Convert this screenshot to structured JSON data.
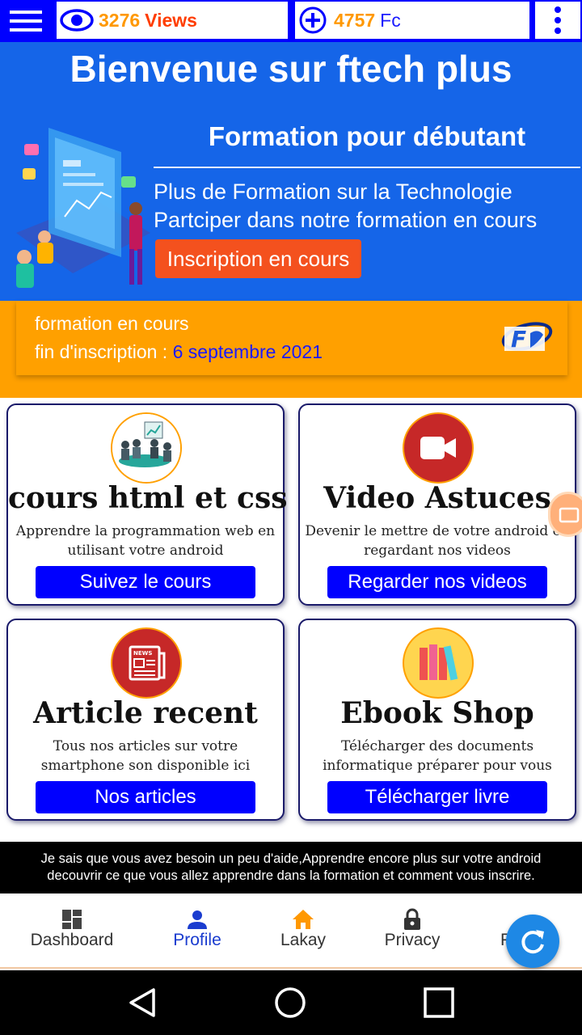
{
  "topbar": {
    "views_count": "3276",
    "views_label": "Views",
    "fc_count": "4757",
    "fc_label": "Fc",
    "icons": [
      "menu-icon",
      "eye-icon",
      "plus-circle-icon",
      "more-vert-icon"
    ]
  },
  "hero": {
    "title": "Bienvenue sur ftech plus",
    "subtitle": "Formation pour débutant",
    "line1": "Plus de Formation sur la Technologie",
    "line2": "Partciper dans notre formation en cours",
    "button": "Inscription en cours"
  },
  "band": {
    "line1": "formation en cours",
    "line2_label": "fin d'inscription :",
    "line2_date": "6 septembre 2021"
  },
  "cards": [
    {
      "title": "cours html et css",
      "desc": "Apprendre la programmation web en utilisant votre android",
      "button": "Suivez le cours",
      "icon": "meeting-icon"
    },
    {
      "title": "Video Astuces",
      "desc": "Devenir le mettre de votre android en regardant nos videos",
      "button": "Regarder nos videos",
      "icon": "video-camera-icon"
    },
    {
      "title": "Article recent",
      "desc": "Tous nos articles sur votre smartphone son disponible ici",
      "button": "Nos articles",
      "icon": "newspaper-icon"
    },
    {
      "title": "Ebook Shop",
      "desc": "Télécharger des documents informatique préparer pour vous",
      "button": "Télécharger livre",
      "icon": "books-icon"
    }
  ],
  "info_banner": {
    "line1": "Je sais que vous avez besoin un peu d'aide,Apprendre encore plus sur votre android",
    "line2": "decouvrir ce que vous allez apprendre dans la formation et comment vous inscrire."
  },
  "bottom_nav": {
    "items": [
      {
        "label": "Dashboard",
        "icon": "dashboard-icon"
      },
      {
        "label": "Profile",
        "icon": "person-icon",
        "active": true
      },
      {
        "label": "Lakay",
        "icon": "home-icon"
      },
      {
        "label": "Privacy",
        "icon": "lock-icon"
      },
      {
        "label": "P",
        "icon": "partial-icon"
      }
    ]
  },
  "colors": {
    "topbar": "#0000ff",
    "hero": "#1565e8",
    "accent_orange": "#ffa000",
    "hero_button": "#f4511e",
    "card_button": "#0000ff",
    "nav_active": "#1a3ccf",
    "lakay_icon": "#ff9800"
  }
}
